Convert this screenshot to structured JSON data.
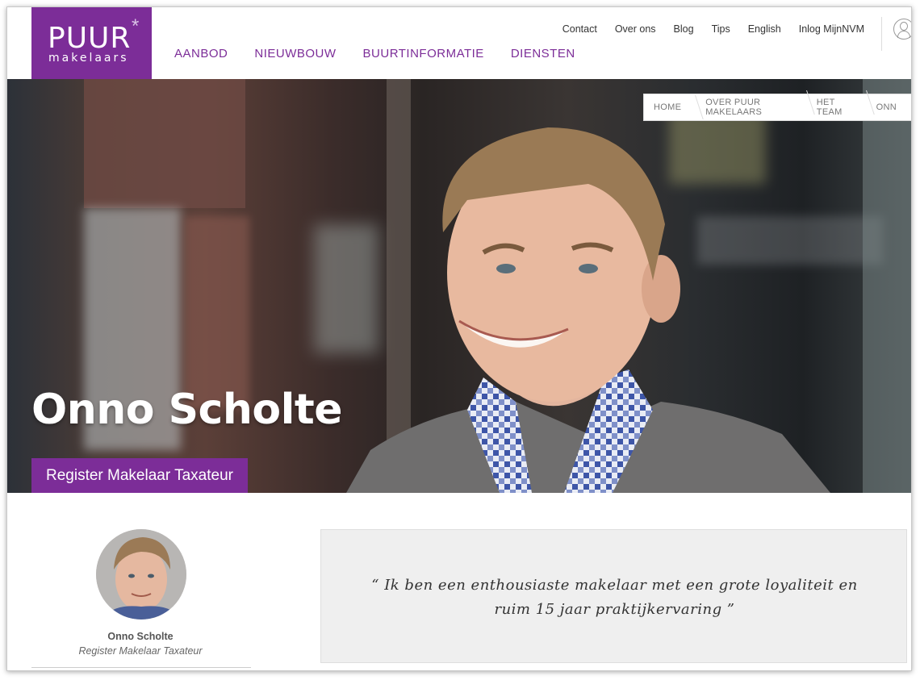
{
  "logo": {
    "name": "PUUR",
    "star": "*",
    "sub": "makelaars"
  },
  "main_nav": [
    "AANBOD",
    "NIEUWBOUW",
    "BUURTINFORMATIE",
    "DIENSTEN"
  ],
  "top_links": [
    "Contact",
    "Over ons",
    "Blog",
    "Tips",
    "English",
    "Inlog MijnNVM"
  ],
  "breadcrumb": [
    "HOME",
    "OVER PUUR MAKELAARS",
    "HET TEAM",
    "ONN"
  ],
  "hero": {
    "name": "Onno Scholte",
    "title": "Register Makelaar Taxateur"
  },
  "profile": {
    "name": "Onno Scholte",
    "role": "Register Makelaar Taxateur"
  },
  "quote": {
    "text": "“ Ik ben een enthousiaste makelaar met een grote loyaliteit en ruim 15 jaar praktijkervaring ”"
  },
  "colors": {
    "brand": "#7c2d98",
    "quote_bg": "#efefef"
  },
  "icons": {
    "user": "user-account-icon"
  }
}
